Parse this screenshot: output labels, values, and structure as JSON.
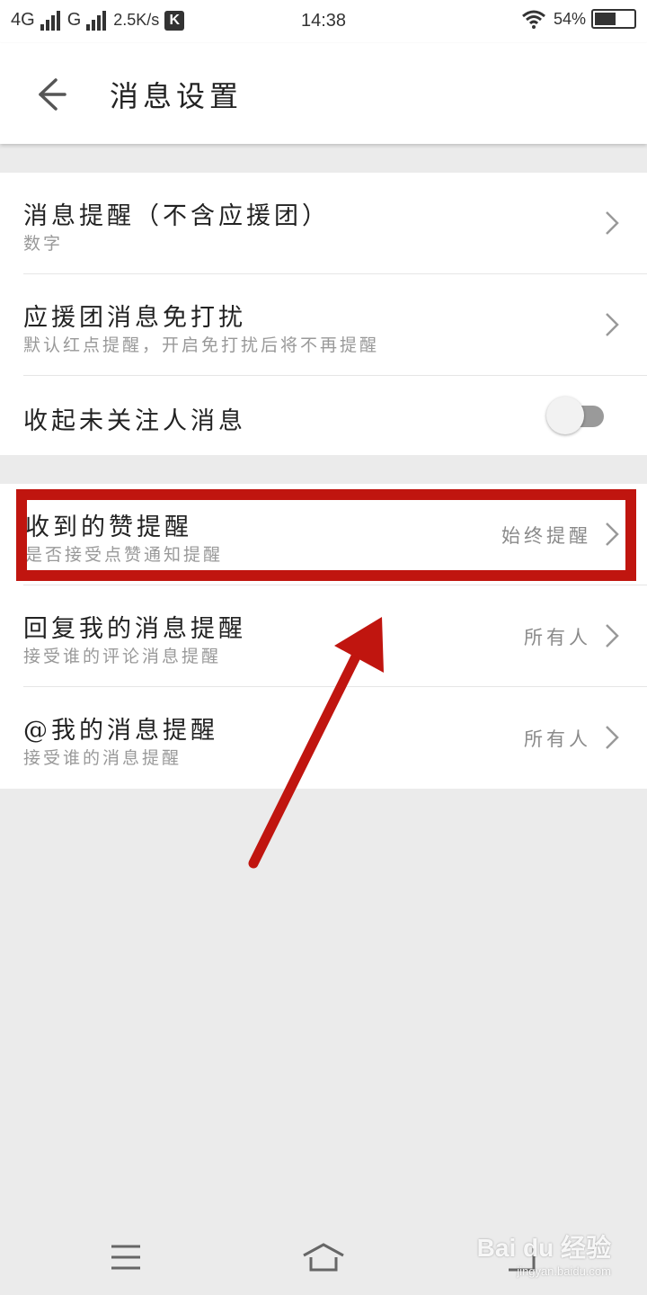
{
  "status_bar": {
    "network1": "4G",
    "network2": "G",
    "speed": "2.5K/s",
    "badge": "K",
    "time": "14:38",
    "battery": "54%",
    "battery_level": 0.54
  },
  "header": {
    "title": "消息设置",
    "back_icon": "arrow-left-icon"
  },
  "group1": [
    {
      "title": "消息提醒（不含应援团）",
      "subtitle": "数字"
    },
    {
      "title": "应援团消息免打扰",
      "subtitle": "默认红点提醒，开启免打扰后将不再提醒"
    },
    {
      "title": "收起未关注人消息",
      "toggle_on": false
    }
  ],
  "group2": [
    {
      "title": "收到的赞提醒",
      "subtitle": "是否接受点赞通知提醒",
      "value": "始终提醒"
    },
    {
      "title": "回复我的消息提醒",
      "subtitle": "接受谁的评论消息提醒",
      "value": "所有人"
    },
    {
      "title": "@我的消息提醒",
      "subtitle": "接受谁的消息提醒",
      "value": "所有人"
    }
  ],
  "colors": {
    "highlight": "#c0150f",
    "background": "#ebebeb",
    "toggle_track": "#9a9a9a"
  },
  "nav": {
    "menu_icon": "menu-icon",
    "home_icon": "home-icon",
    "back_icon": "back-icon"
  },
  "watermark": {
    "brand": "Bai du 经验",
    "url": "jingyan.baidu.com"
  }
}
